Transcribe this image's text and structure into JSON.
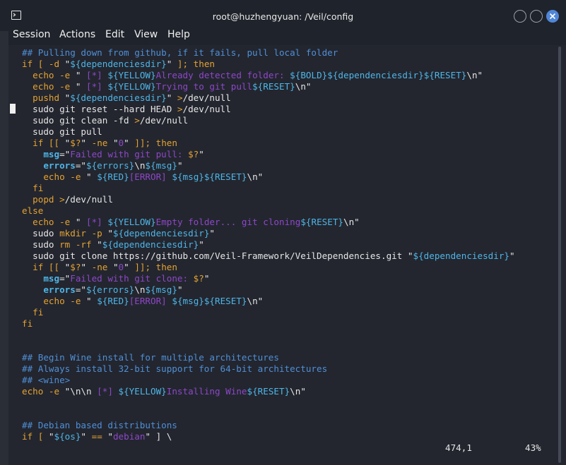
{
  "window": {
    "title": "root@huzhengyuan: /Veil/config",
    "icon": "terminal-icon",
    "controls": [
      "minimize-icon",
      "maximize-icon",
      "close-icon"
    ]
  },
  "menu": [
    "Session",
    "Actions",
    "Edit",
    "View",
    "Help"
  ],
  "status": {
    "position": "474,1",
    "percent": "43%"
  },
  "colors": {
    "comment": "#4f8fd6",
    "keyword": "#e5a232",
    "variable": "#4fb6e8",
    "string": "#8e47c8",
    "text": "#e6e6e6",
    "close_button": "#4f86d8"
  },
  "code_lines": [
    [
      [
        "c",
        "## Pulling down from github, if it fails, pull local folder"
      ]
    ],
    [
      [
        "k",
        "if [ -d "
      ],
      [
        "s",
        "\""
      ],
      [
        "v",
        "${dependenciesdir}"
      ],
      [
        "s",
        "\""
      ],
      [
        "k",
        " ]; then"
      ]
    ],
    [
      [
        "s",
        "  "
      ],
      [
        "k",
        "echo -e "
      ],
      [
        "s",
        "\" "
      ],
      [
        "p",
        "[*] "
      ],
      [
        "v",
        "${YELLOW}"
      ],
      [
        "p",
        "Already detected folder: "
      ],
      [
        "v",
        "${BOLD}${dependenciesdir}${RESET}"
      ],
      [
        "s",
        "\\n\""
      ]
    ],
    [
      [
        "s",
        "  "
      ],
      [
        "k",
        "echo -e "
      ],
      [
        "s",
        "\" "
      ],
      [
        "p",
        "[*] "
      ],
      [
        "v",
        "${YELLOW}"
      ],
      [
        "p",
        "Trying to git pull"
      ],
      [
        "v",
        "${RESET}"
      ],
      [
        "s",
        "\\n\""
      ]
    ],
    [
      [
        "s",
        "  "
      ],
      [
        "k",
        "pushd "
      ],
      [
        "s",
        "\""
      ],
      [
        "v",
        "${dependenciesdir}"
      ],
      [
        "s",
        "\" "
      ],
      [
        "k",
        ">"
      ],
      [
        "s",
        "/dev/null"
      ]
    ],
    [
      [
        "s",
        "  sudo git reset --hard HEAD "
      ],
      [
        "k",
        ">"
      ],
      [
        "s",
        "/dev/null"
      ]
    ],
    [
      [
        "s",
        "  sudo git clean -fd "
      ],
      [
        "k",
        ">"
      ],
      [
        "s",
        "/dev/null"
      ]
    ],
    [
      [
        "s",
        "  sudo git pull"
      ]
    ],
    [
      [
        "s",
        "  "
      ],
      [
        "k",
        "if [[ "
      ],
      [
        "s",
        "\""
      ],
      [
        "k",
        "$?"
      ],
      [
        "s",
        "\" "
      ],
      [
        "k",
        "-ne "
      ],
      [
        "s",
        "\""
      ],
      [
        "p",
        "0"
      ],
      [
        "s",
        "\""
      ],
      [
        "k",
        " ]]; then"
      ]
    ],
    [
      [
        "s",
        "    "
      ],
      [
        "b",
        "msg"
      ],
      [
        "s",
        "=\""
      ],
      [
        "p",
        "Failed with git pull: "
      ],
      [
        "k",
        "$?"
      ],
      [
        "s",
        "\""
      ]
    ],
    [
      [
        "s",
        "    "
      ],
      [
        "b",
        "errors"
      ],
      [
        "s",
        "=\""
      ],
      [
        "v",
        "${errors}"
      ],
      [
        "s",
        "\\n"
      ],
      [
        "v",
        "${msg}"
      ],
      [
        "s",
        "\""
      ]
    ],
    [
      [
        "s",
        "    "
      ],
      [
        "k",
        "echo -e "
      ],
      [
        "s",
        "\" "
      ],
      [
        "v",
        "${RED}"
      ],
      [
        "p",
        "[ERROR] "
      ],
      [
        "v",
        "${msg}${RESET}"
      ],
      [
        "s",
        "\\n\""
      ]
    ],
    [
      [
        "s",
        "  "
      ],
      [
        "k",
        "fi"
      ]
    ],
    [
      [
        "s",
        "  "
      ],
      [
        "k",
        "popd "
      ],
      [
        "k",
        ">"
      ],
      [
        "s",
        "/dev/null"
      ]
    ],
    [
      [
        "k",
        "else"
      ]
    ],
    [
      [
        "s",
        "  "
      ],
      [
        "k",
        "echo -e "
      ],
      [
        "s",
        "\" "
      ],
      [
        "p",
        "[*] "
      ],
      [
        "v",
        "${YELLOW}"
      ],
      [
        "p",
        "Empty folder... git cloning"
      ],
      [
        "v",
        "${RESET}"
      ],
      [
        "s",
        "\\n\""
      ]
    ],
    [
      [
        "s",
        "  sudo "
      ],
      [
        "k",
        "mkdir -p "
      ],
      [
        "s",
        "\""
      ],
      [
        "v",
        "${dependenciesdir}"
      ],
      [
        "s",
        "\""
      ]
    ],
    [
      [
        "s",
        "  sudo "
      ],
      [
        "k",
        "rm -rf "
      ],
      [
        "s",
        "\""
      ],
      [
        "v",
        "${dependenciesdir}"
      ],
      [
        "s",
        "\""
      ]
    ],
    [
      [
        "s",
        "  sudo git clone https://github.com/Veil-Framework/VeilDependencies.git \""
      ],
      [
        "v",
        "${dependenciesdir}"
      ],
      [
        "s",
        "\""
      ]
    ],
    [
      [
        "s",
        "  "
      ],
      [
        "k",
        "if [[ "
      ],
      [
        "s",
        "\""
      ],
      [
        "k",
        "$?"
      ],
      [
        "s",
        "\" "
      ],
      [
        "k",
        "-ne "
      ],
      [
        "s",
        "\""
      ],
      [
        "p",
        "0"
      ],
      [
        "s",
        "\""
      ],
      [
        "k",
        " ]]; then"
      ]
    ],
    [
      [
        "s",
        "    "
      ],
      [
        "b",
        "msg"
      ],
      [
        "s",
        "=\""
      ],
      [
        "p",
        "Failed with git clone: "
      ],
      [
        "k",
        "$?"
      ],
      [
        "s",
        "\""
      ]
    ],
    [
      [
        "s",
        "    "
      ],
      [
        "b",
        "errors"
      ],
      [
        "s",
        "=\""
      ],
      [
        "v",
        "${errors}"
      ],
      [
        "s",
        "\\n"
      ],
      [
        "v",
        "${msg}"
      ],
      [
        "s",
        "\""
      ]
    ],
    [
      [
        "s",
        "    "
      ],
      [
        "k",
        "echo -e "
      ],
      [
        "s",
        "\" "
      ],
      [
        "v",
        "${RED}"
      ],
      [
        "p",
        "[ERROR] "
      ],
      [
        "v",
        "${msg}${RESET}"
      ],
      [
        "s",
        "\\n\""
      ]
    ],
    [
      [
        "s",
        "  "
      ],
      [
        "k",
        "fi"
      ]
    ],
    [
      [
        "k",
        "fi"
      ]
    ],
    [
      [
        "s",
        ""
      ]
    ],
    [
      [
        "s",
        ""
      ]
    ],
    [
      [
        "c",
        "## Begin Wine install for multiple architectures"
      ]
    ],
    [
      [
        "c",
        "## Always install 32-bit support for 64-bit architectures"
      ]
    ],
    [
      [
        "c",
        "## <wine>"
      ]
    ],
    [
      [
        "k",
        "echo -e "
      ],
      [
        "s",
        "\"\\n\\n "
      ],
      [
        "p",
        "[*] "
      ],
      [
        "v",
        "${YELLOW}"
      ],
      [
        "p",
        "Installing Wine"
      ],
      [
        "v",
        "${RESET}"
      ],
      [
        "s",
        "\\n\""
      ]
    ],
    [
      [
        "s",
        ""
      ]
    ],
    [
      [
        "s",
        ""
      ]
    ],
    [
      [
        "c",
        "## Debian based distributions"
      ]
    ],
    [
      [
        "k",
        "if [ "
      ],
      [
        "s",
        "\""
      ],
      [
        "v",
        "${os}"
      ],
      [
        "s",
        "\" "
      ],
      [
        "k",
        "== "
      ],
      [
        "s",
        "\""
      ],
      [
        "p",
        "debian"
      ],
      [
        "s",
        "\" ] \\"
      ]
    ]
  ]
}
